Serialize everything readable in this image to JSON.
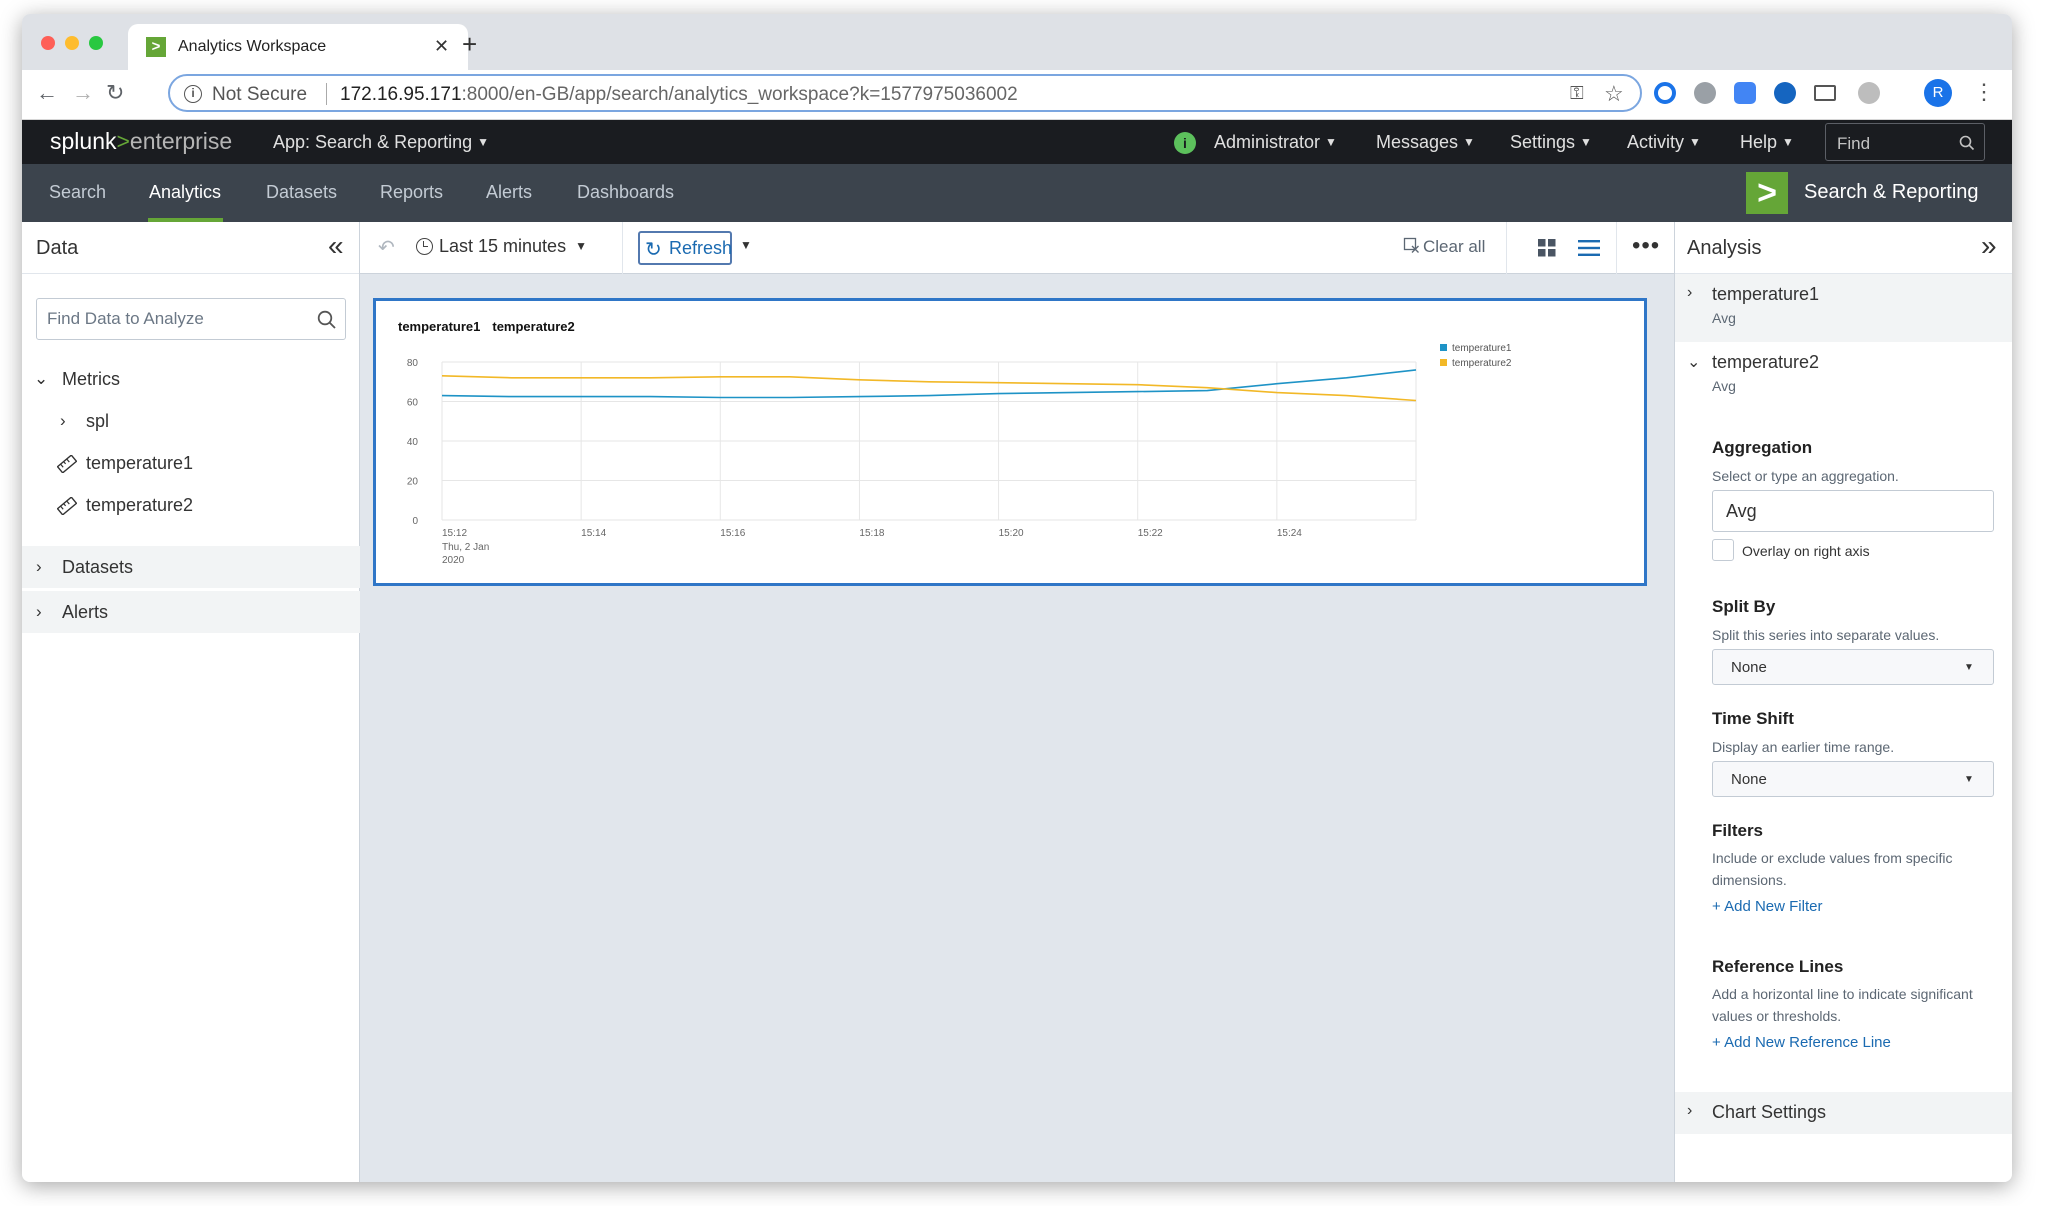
{
  "browser": {
    "tab_title": "Analytics Workspace",
    "tab_close": "✕",
    "new_tab": "+",
    "security_label": "Not Secure",
    "url_host": "172.16.95.171",
    "url_rest": ":8000/en-GB/app/search/analytics_workspace?k=1577975036002",
    "profile_initial": "R"
  },
  "appbar": {
    "logo_a": "splunk",
    "logo_b": ">",
    "logo_c": "enterprise",
    "app_menu": "App: Search & Reporting",
    "menus": [
      "Administrator",
      "Messages",
      "Settings",
      "Activity",
      "Help"
    ],
    "find_placeholder": "Find"
  },
  "nav": {
    "items": [
      "Search",
      "Analytics",
      "Datasets",
      "Reports",
      "Alerts",
      "Dashboards"
    ],
    "active": "Analytics",
    "app_label": "Search & Reporting"
  },
  "left": {
    "title": "Data",
    "search_placeholder": "Find Data to Analyze",
    "metrics": "Metrics",
    "spl": "spl",
    "metric_items": [
      "temperature1",
      "temperature2"
    ],
    "datasets": "Datasets",
    "alerts": "Alerts"
  },
  "toolbar": {
    "time_range": "Last 15 minutes",
    "refresh": "Refresh",
    "clear_all": "Clear all",
    "more": "•••"
  },
  "panel": {
    "titles": [
      "temperature1",
      "temperature2"
    ]
  },
  "chart_data": {
    "type": "line",
    "x": [
      "15:12",
      "15:13",
      "15:14",
      "15:15",
      "15:16",
      "15:17",
      "15:18",
      "15:19",
      "15:20",
      "15:21",
      "15:22",
      "15:23",
      "15:24",
      "15:25",
      "15:26"
    ],
    "x_tick_labels": [
      "15:12",
      "15:14",
      "15:16",
      "15:18",
      "15:20",
      "15:22",
      "15:24"
    ],
    "x_first_tick_sublabels": [
      "Thu, 2 Jan",
      "2020"
    ],
    "yticks": [
      0,
      20,
      40,
      60,
      80
    ],
    "ylim": [
      0,
      80
    ],
    "series": [
      {
        "name": "temperature1",
        "color": "#1e93c6",
        "values": [
          63,
          62.5,
          62.5,
          62.5,
          62,
          62,
          62.5,
          63,
          64,
          64.5,
          65,
          65.5,
          69,
          72,
          76
        ]
      },
      {
        "name": "temperature2",
        "color": "#f2b827",
        "values": [
          73,
          72,
          72,
          72,
          72.5,
          72.5,
          71,
          70,
          69.5,
          69,
          68.5,
          67,
          64.5,
          63,
          60.5
        ]
      }
    ],
    "legend_position": "right",
    "grid": true
  },
  "right": {
    "title": "Analysis",
    "series": [
      {
        "name": "temperature1",
        "agg": "Avg"
      },
      {
        "name": "temperature2",
        "agg": "Avg"
      }
    ],
    "aggregation_title": "Aggregation",
    "aggregation_help": "Select or type an aggregation.",
    "aggregation_value": "Avg",
    "overlay_label": "Overlay on right axis",
    "splitby_title": "Split By",
    "splitby_help": "Split this series into separate values.",
    "splitby_value": "None",
    "timeshift_title": "Time Shift",
    "timeshift_help": "Display an earlier time range.",
    "timeshift_value": "None",
    "filters_title": "Filters",
    "filters_help": "Include or exclude values from specific dimensions.",
    "filters_link": "+ Add New Filter",
    "reflines_title": "Reference Lines",
    "reflines_help": "Add a horizontal line to indicate significant values or thresholds.",
    "reflines_link": "+ Add New Reference Line",
    "chart_settings": "Chart Settings"
  }
}
